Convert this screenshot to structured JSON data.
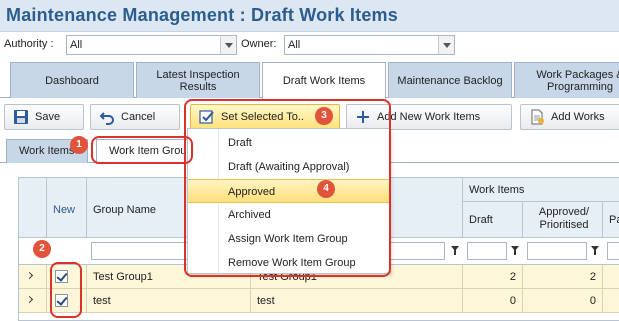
{
  "header": {
    "title": "Maintenance Management : Draft Work Items"
  },
  "filters": {
    "authority_label": "Authority :",
    "authority_value": "All",
    "owner_label": "Owner:",
    "owner_value": "All"
  },
  "main_tabs": [
    {
      "label": "Dashboard",
      "active": false
    },
    {
      "label": "Latest Inspection Results",
      "active": false
    },
    {
      "label": "Draft Work Items",
      "active": true
    },
    {
      "label": "Maintenance Backlog",
      "active": false
    },
    {
      "label": "Work Packages & Programming",
      "active": false
    }
  ],
  "toolbar": {
    "save_label": "Save",
    "cancel_label": "Cancel",
    "set_selected_label": "Set Selected To..",
    "add_new_label": "Add New Work Items",
    "add_works_label": "Add Works"
  },
  "sub_tabs": [
    {
      "label": "Work Items",
      "active": false
    },
    {
      "label": "Work Item Group",
      "active": true
    }
  ],
  "dropdown_menu": {
    "items": [
      "Draft",
      "Draft (Awaiting Approval)",
      "Approved",
      "Archived",
      "Assign Work Item Group",
      "Remove Work Item Group"
    ],
    "selected": "Approved"
  },
  "grid": {
    "headers": {
      "new": "New",
      "group_name": "Group Name",
      "work_items": "Work Items",
      "draft": "Draft",
      "approved": "Approved/ Prioritised",
      "pa": "Pa"
    },
    "rows": [
      {
        "checked": true,
        "group_name": "Test Group1",
        "description": "Test Group1",
        "draft": "2",
        "approved": "2"
      },
      {
        "checked": true,
        "group_name": "test",
        "description": "test",
        "draft": "0",
        "approved": "0"
      }
    ]
  },
  "annotations": {
    "badge1": "1",
    "badge2": "2",
    "badge3": "3",
    "badge4": "4"
  },
  "colors": {
    "accent": "#2b5d8f",
    "annotation_red": "#d9322a",
    "highlight_yellow": "#ffde7a"
  }
}
